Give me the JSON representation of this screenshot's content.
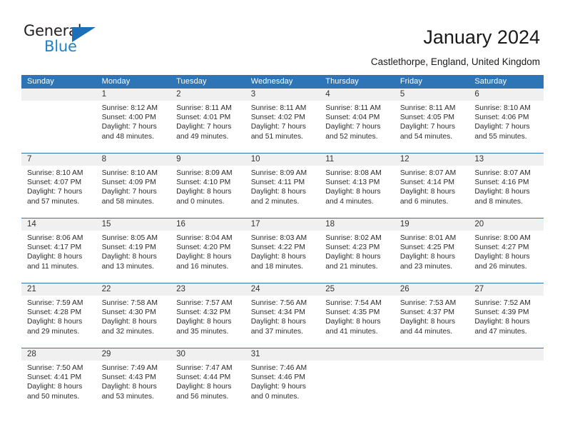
{
  "brand": {
    "name_part1": "General",
    "name_part2": "Blue",
    "triangle_icon": "triangle-icon",
    "accent_dark": "#231f20",
    "accent_blue": "#1d83c9",
    "triangle_blue": "#1d6fb8"
  },
  "header": {
    "title": "January 2024",
    "subtitle": "Castlethorpe, England, United Kingdom"
  },
  "calendar": {
    "header_bg": "#2f74b5",
    "daynum_bg": "#f0f0f0",
    "weekdays": [
      "Sunday",
      "Monday",
      "Tuesday",
      "Wednesday",
      "Thursday",
      "Friday",
      "Saturday"
    ],
    "weeks": [
      [
        {
          "day": "",
          "sunrise": "",
          "sunset": "",
          "daylight1": "",
          "daylight2": ""
        },
        {
          "day": "1",
          "sunrise": "Sunrise: 8:12 AM",
          "sunset": "Sunset: 4:00 PM",
          "daylight1": "Daylight: 7 hours",
          "daylight2": "and 48 minutes."
        },
        {
          "day": "2",
          "sunrise": "Sunrise: 8:11 AM",
          "sunset": "Sunset: 4:01 PM",
          "daylight1": "Daylight: 7 hours",
          "daylight2": "and 49 minutes."
        },
        {
          "day": "3",
          "sunrise": "Sunrise: 8:11 AM",
          "sunset": "Sunset: 4:02 PM",
          "daylight1": "Daylight: 7 hours",
          "daylight2": "and 51 minutes."
        },
        {
          "day": "4",
          "sunrise": "Sunrise: 8:11 AM",
          "sunset": "Sunset: 4:04 PM",
          "daylight1": "Daylight: 7 hours",
          "daylight2": "and 52 minutes."
        },
        {
          "day": "5",
          "sunrise": "Sunrise: 8:11 AM",
          "sunset": "Sunset: 4:05 PM",
          "daylight1": "Daylight: 7 hours",
          "daylight2": "and 54 minutes."
        },
        {
          "day": "6",
          "sunrise": "Sunrise: 8:10 AM",
          "sunset": "Sunset: 4:06 PM",
          "daylight1": "Daylight: 7 hours",
          "daylight2": "and 55 minutes."
        }
      ],
      [
        {
          "day": "7",
          "sunrise": "Sunrise: 8:10 AM",
          "sunset": "Sunset: 4:07 PM",
          "daylight1": "Daylight: 7 hours",
          "daylight2": "and 57 minutes."
        },
        {
          "day": "8",
          "sunrise": "Sunrise: 8:10 AM",
          "sunset": "Sunset: 4:09 PM",
          "daylight1": "Daylight: 7 hours",
          "daylight2": "and 58 minutes."
        },
        {
          "day": "9",
          "sunrise": "Sunrise: 8:09 AM",
          "sunset": "Sunset: 4:10 PM",
          "daylight1": "Daylight: 8 hours",
          "daylight2": "and 0 minutes."
        },
        {
          "day": "10",
          "sunrise": "Sunrise: 8:09 AM",
          "sunset": "Sunset: 4:11 PM",
          "daylight1": "Daylight: 8 hours",
          "daylight2": "and 2 minutes."
        },
        {
          "day": "11",
          "sunrise": "Sunrise: 8:08 AM",
          "sunset": "Sunset: 4:13 PM",
          "daylight1": "Daylight: 8 hours",
          "daylight2": "and 4 minutes."
        },
        {
          "day": "12",
          "sunrise": "Sunrise: 8:07 AM",
          "sunset": "Sunset: 4:14 PM",
          "daylight1": "Daylight: 8 hours",
          "daylight2": "and 6 minutes."
        },
        {
          "day": "13",
          "sunrise": "Sunrise: 8:07 AM",
          "sunset": "Sunset: 4:16 PM",
          "daylight1": "Daylight: 8 hours",
          "daylight2": "and 8 minutes."
        }
      ],
      [
        {
          "day": "14",
          "sunrise": "Sunrise: 8:06 AM",
          "sunset": "Sunset: 4:17 PM",
          "daylight1": "Daylight: 8 hours",
          "daylight2": "and 11 minutes."
        },
        {
          "day": "15",
          "sunrise": "Sunrise: 8:05 AM",
          "sunset": "Sunset: 4:19 PM",
          "daylight1": "Daylight: 8 hours",
          "daylight2": "and 13 minutes."
        },
        {
          "day": "16",
          "sunrise": "Sunrise: 8:04 AM",
          "sunset": "Sunset: 4:20 PM",
          "daylight1": "Daylight: 8 hours",
          "daylight2": "and 16 minutes."
        },
        {
          "day": "17",
          "sunrise": "Sunrise: 8:03 AM",
          "sunset": "Sunset: 4:22 PM",
          "daylight1": "Daylight: 8 hours",
          "daylight2": "and 18 minutes."
        },
        {
          "day": "18",
          "sunrise": "Sunrise: 8:02 AM",
          "sunset": "Sunset: 4:23 PM",
          "daylight1": "Daylight: 8 hours",
          "daylight2": "and 21 minutes."
        },
        {
          "day": "19",
          "sunrise": "Sunrise: 8:01 AM",
          "sunset": "Sunset: 4:25 PM",
          "daylight1": "Daylight: 8 hours",
          "daylight2": "and 23 minutes."
        },
        {
          "day": "20",
          "sunrise": "Sunrise: 8:00 AM",
          "sunset": "Sunset: 4:27 PM",
          "daylight1": "Daylight: 8 hours",
          "daylight2": "and 26 minutes."
        }
      ],
      [
        {
          "day": "21",
          "sunrise": "Sunrise: 7:59 AM",
          "sunset": "Sunset: 4:28 PM",
          "daylight1": "Daylight: 8 hours",
          "daylight2": "and 29 minutes."
        },
        {
          "day": "22",
          "sunrise": "Sunrise: 7:58 AM",
          "sunset": "Sunset: 4:30 PM",
          "daylight1": "Daylight: 8 hours",
          "daylight2": "and 32 minutes."
        },
        {
          "day": "23",
          "sunrise": "Sunrise: 7:57 AM",
          "sunset": "Sunset: 4:32 PM",
          "daylight1": "Daylight: 8 hours",
          "daylight2": "and 35 minutes."
        },
        {
          "day": "24",
          "sunrise": "Sunrise: 7:56 AM",
          "sunset": "Sunset: 4:34 PM",
          "daylight1": "Daylight: 8 hours",
          "daylight2": "and 37 minutes."
        },
        {
          "day": "25",
          "sunrise": "Sunrise: 7:54 AM",
          "sunset": "Sunset: 4:35 PM",
          "daylight1": "Daylight: 8 hours",
          "daylight2": "and 41 minutes."
        },
        {
          "day": "26",
          "sunrise": "Sunrise: 7:53 AM",
          "sunset": "Sunset: 4:37 PM",
          "daylight1": "Daylight: 8 hours",
          "daylight2": "and 44 minutes."
        },
        {
          "day": "27",
          "sunrise": "Sunrise: 7:52 AM",
          "sunset": "Sunset: 4:39 PM",
          "daylight1": "Daylight: 8 hours",
          "daylight2": "and 47 minutes."
        }
      ],
      [
        {
          "day": "28",
          "sunrise": "Sunrise: 7:50 AM",
          "sunset": "Sunset: 4:41 PM",
          "daylight1": "Daylight: 8 hours",
          "daylight2": "and 50 minutes."
        },
        {
          "day": "29",
          "sunrise": "Sunrise: 7:49 AM",
          "sunset": "Sunset: 4:43 PM",
          "daylight1": "Daylight: 8 hours",
          "daylight2": "and 53 minutes."
        },
        {
          "day": "30",
          "sunrise": "Sunrise: 7:47 AM",
          "sunset": "Sunset: 4:44 PM",
          "daylight1": "Daylight: 8 hours",
          "daylight2": "and 56 minutes."
        },
        {
          "day": "31",
          "sunrise": "Sunrise: 7:46 AM",
          "sunset": "Sunset: 4:46 PM",
          "daylight1": "Daylight: 9 hours",
          "daylight2": "and 0 minutes."
        },
        {
          "day": "",
          "sunrise": "",
          "sunset": "",
          "daylight1": "",
          "daylight2": ""
        },
        {
          "day": "",
          "sunrise": "",
          "sunset": "",
          "daylight1": "",
          "daylight2": ""
        },
        {
          "day": "",
          "sunrise": "",
          "sunset": "",
          "daylight1": "",
          "daylight2": ""
        }
      ]
    ]
  }
}
